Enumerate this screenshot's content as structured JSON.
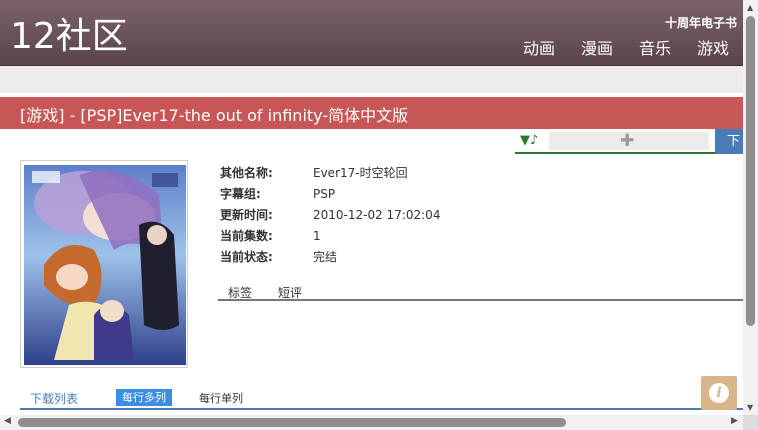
{
  "site": {
    "logo": "12社区",
    "tagline": "十周年电子书"
  },
  "nav": {
    "items": [
      "动画",
      "漫画",
      "音乐",
      "游戏"
    ]
  },
  "page": {
    "title": "[游戏] - [PSP]Ever17-the out of infinity-简体中文版"
  },
  "player": {
    "music_icon": "▼♪",
    "download_label": "下"
  },
  "details": [
    {
      "label": "其他名称:",
      "value": "Ever17-时空轮回"
    },
    {
      "label": "字幕组:",
      "value": "PSP"
    },
    {
      "label": "更新时间:",
      "value": "2010-12-02 17:02:04"
    },
    {
      "label": "当前集数:",
      "value": "1"
    },
    {
      "label": "当前状态:",
      "value": "完结"
    }
  ],
  "subtabs": {
    "tags": "标签",
    "reviews": "短评"
  },
  "downloads": {
    "label": "下载列表",
    "multi": "每行多列",
    "single": "每行单列"
  },
  "colors": {
    "header": "#6a5359",
    "title_bar": "#c85656",
    "accent_blue": "#3a8ee6",
    "music_green": "#2a7a2a",
    "info_btn": "#d9b58a"
  }
}
